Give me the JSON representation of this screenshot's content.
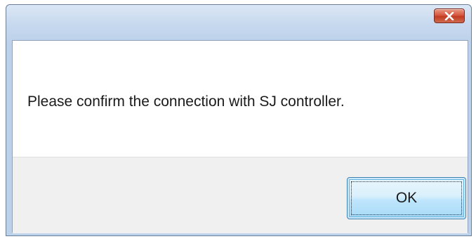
{
  "dialog": {
    "title": "",
    "close_icon": "close-icon",
    "message": "Please confirm the connection with SJ controller.",
    "ok_label": "OK"
  },
  "colors": {
    "title_bar": "#c6d8ee",
    "close_button": "#c23b21",
    "ok_button": "#bee6fd",
    "ok_border": "#3c7fb1"
  }
}
